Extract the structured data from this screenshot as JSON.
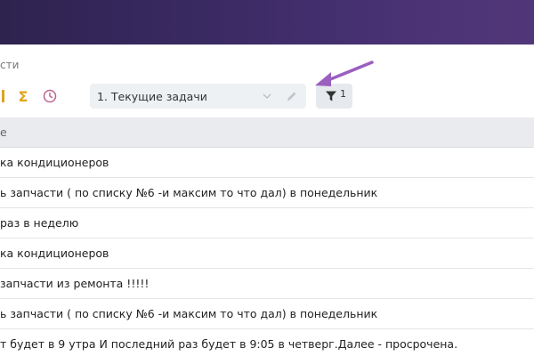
{
  "breadcrumb": "сти",
  "toolbar": {
    "sigma_icon": "Σ",
    "view_select_value": "1. Текущие задачи",
    "filter_count": "1"
  },
  "table": {
    "header": "е",
    "rows": [
      "ка кондиционеров",
      "ь запчасти ( по списку №6 -и максим то что дал) в понедельник",
      "раз в неделю",
      "ка кондиционеров",
      " запчасти из ремонта !!!!!",
      "ь запчасти ( по списку №6 -и максим то что дал) в понедельник",
      "т будет в 9 утра И последний раз будет в 9:05 в четверг.Далее - просрочена."
    ]
  },
  "colors": {
    "header_bar": "#3a2a63",
    "accent_orange": "#e3a21a",
    "clock_pink": "#c0638f",
    "annotation_arrow": "#9b5fc0"
  }
}
